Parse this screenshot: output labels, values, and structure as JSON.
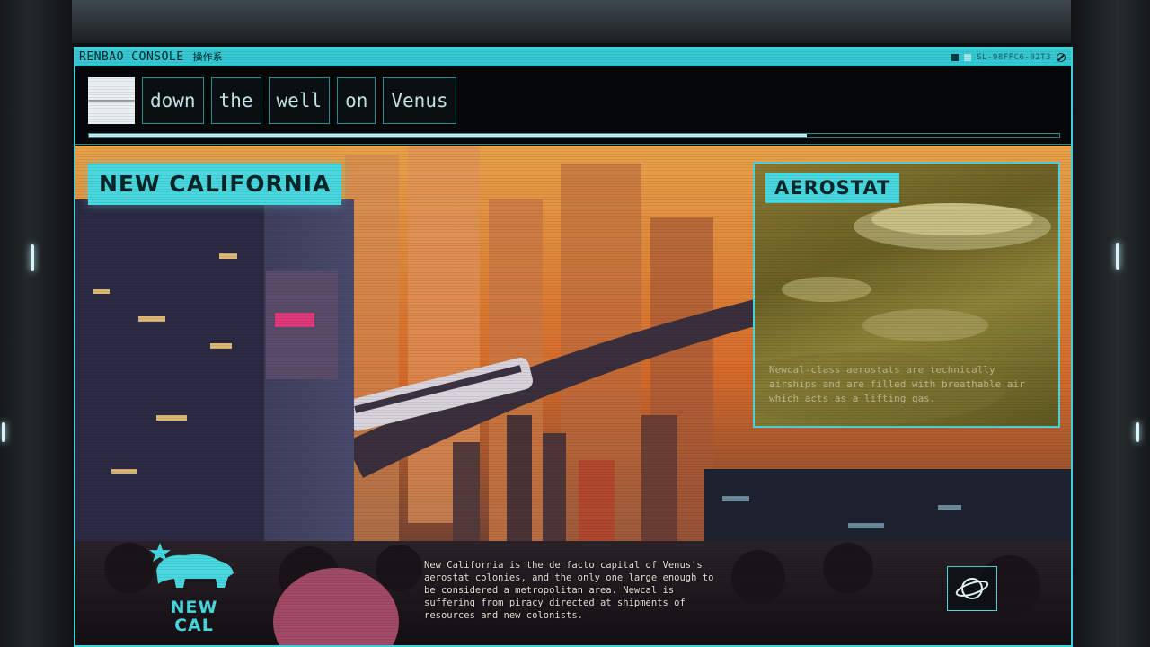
{
  "window": {
    "title": "RENBAO CONSOLE",
    "subtitle": "操作系",
    "status_readout": "SL-98FFC6-02T3"
  },
  "wordbar": {
    "words": [
      "down",
      "the",
      "well",
      "on",
      "Venus"
    ]
  },
  "progress": {
    "value": 0.74
  },
  "main": {
    "city_label": "NEW CALIFORNIA",
    "description": "New California is the de facto capital of Venus's aerostat colonies, and the only one large enough to be considered a metropolitan area. Newcal is suffering from piracy directed at shipments of resources and new colonists.",
    "emblem": {
      "line1": "NEW",
      "line2": "CAL"
    }
  },
  "panel": {
    "title": "AEROSTAT",
    "text": "Newcal-class aerostats are technically airships and are filled with breathable air which acts as a lifting gas."
  },
  "icons": {
    "planet": "planet-icon",
    "close": "close-icon",
    "star": "star-icon",
    "bear": "bear-icon"
  },
  "colors": {
    "accent": "#49d8e0",
    "titlebar": "#36c9d3",
    "background": "#050708"
  }
}
